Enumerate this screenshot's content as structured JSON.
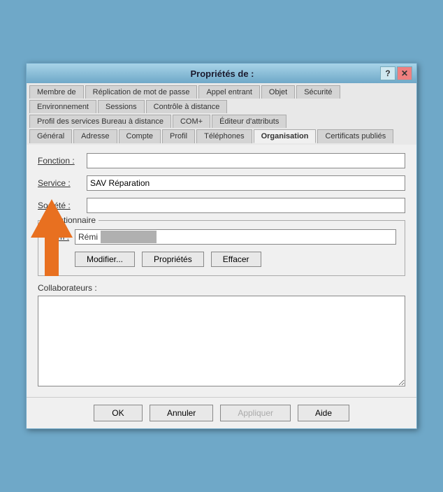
{
  "titleBar": {
    "title": "Propriétés de :",
    "helpBtn": "?",
    "closeBtn": "✕"
  },
  "tabs": {
    "row1": [
      {
        "label": "Membre de",
        "active": false
      },
      {
        "label": "Réplication de mot de passe",
        "active": false
      },
      {
        "label": "Appel entrant",
        "active": false
      },
      {
        "label": "Objet",
        "active": false
      },
      {
        "label": "Sécurité",
        "active": false
      }
    ],
    "row2": [
      {
        "label": "Environnement",
        "active": false
      },
      {
        "label": "Sessions",
        "active": false
      },
      {
        "label": "Contrôle à distance",
        "active": false
      }
    ],
    "row3": [
      {
        "label": "Profil des services Bureau à distance",
        "active": false
      },
      {
        "label": "COM+",
        "active": false
      },
      {
        "label": "Éditeur d'attributs",
        "active": false
      }
    ],
    "row4": [
      {
        "label": "Général",
        "active": false
      },
      {
        "label": "Adresse",
        "active": false
      },
      {
        "label": "Compte",
        "active": false
      },
      {
        "label": "Profil",
        "active": false
      },
      {
        "label": "Téléphones",
        "active": false
      },
      {
        "label": "Organisation",
        "active": true
      },
      {
        "label": "Certificats publiés",
        "active": false
      }
    ]
  },
  "fields": {
    "fonction": {
      "label": "Fonction :",
      "value": "",
      "placeholder": ""
    },
    "service": {
      "label": "Service :",
      "value": "SAV Réparation"
    },
    "societe": {
      "label": "Société :",
      "value": ""
    }
  },
  "groupbox": {
    "legend": "Gestionnaire",
    "nomLabel": "Nom :",
    "nomValue": "Rémi",
    "buttons": {
      "modifier": "Modifier...",
      "proprietes": "Propriétés",
      "effacer": "Effacer"
    }
  },
  "collaborateurs": {
    "label": "Collaborateurs :"
  },
  "footer": {
    "ok": "OK",
    "annuler": "Annuler",
    "appliquer": "Appliquer",
    "aide": "Aide"
  }
}
